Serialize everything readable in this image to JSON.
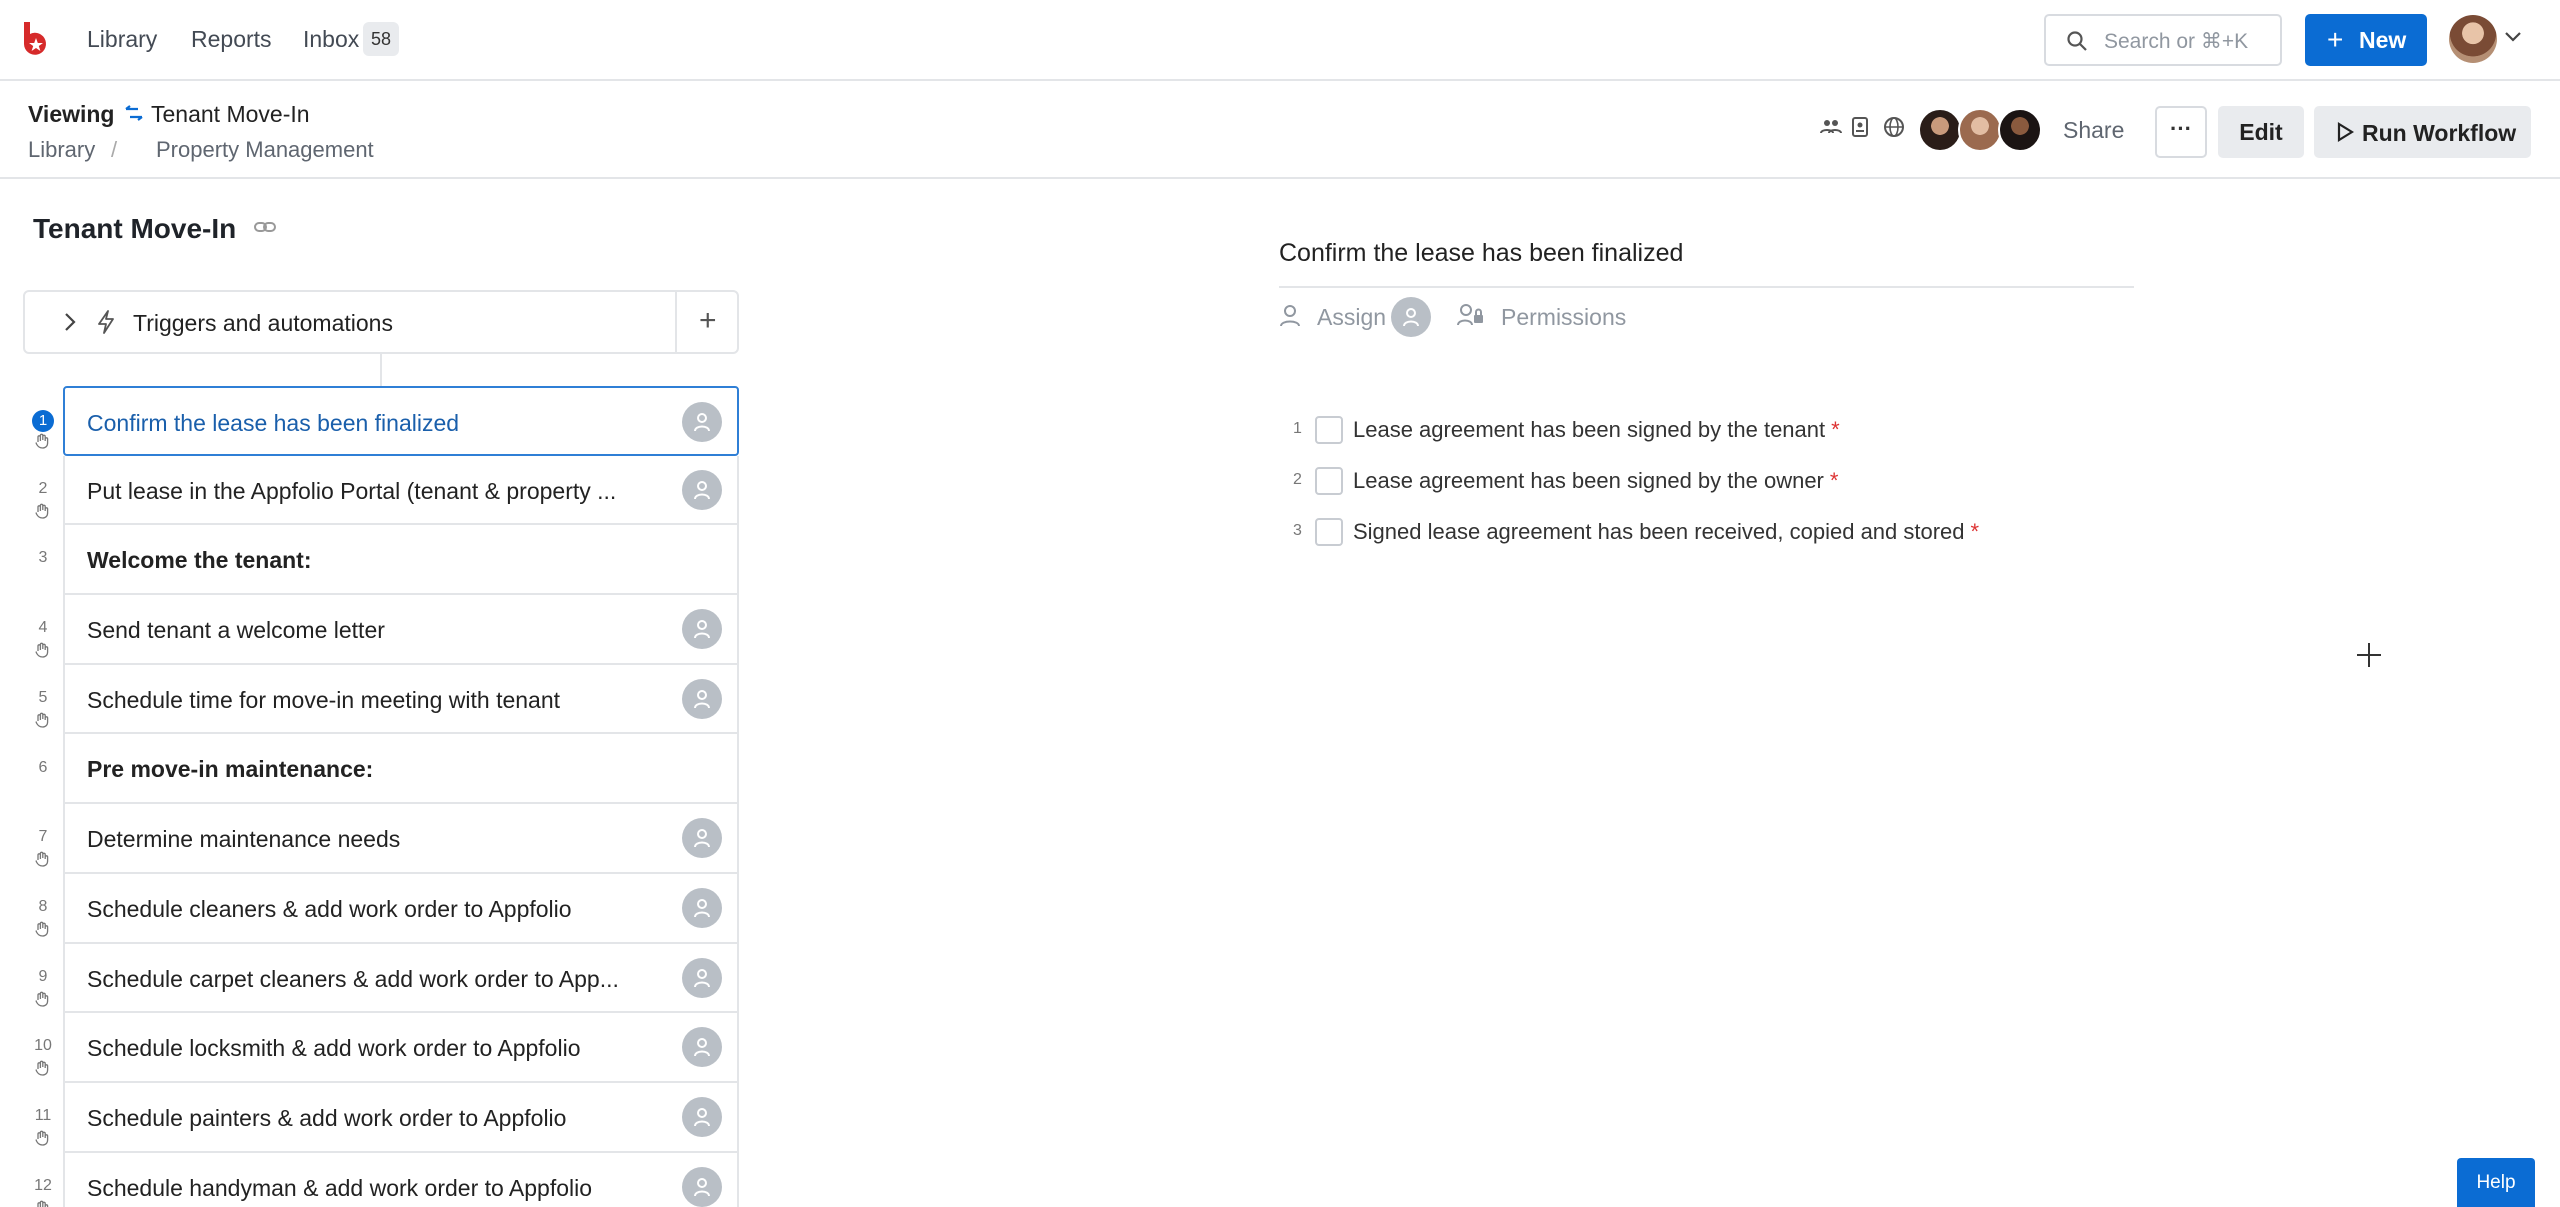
{
  "nav": {
    "library": "Library",
    "reports": "Reports",
    "inbox": "Inbox",
    "inbox_count": "58",
    "search_placeholder": "Search or ⌘+K",
    "new_label": "New"
  },
  "header": {
    "viewing": "Viewing",
    "workflow_title": "Tenant Move-In",
    "breadcrumb": [
      "Library",
      "Property Management"
    ],
    "share": "Share",
    "more": "···",
    "edit": "Edit",
    "run": "Run Workflow"
  },
  "workflow": {
    "title": "Tenant Move-In",
    "triggers_label": "Triggers and automations",
    "add_label": "+",
    "tasks": [
      {
        "num": "1",
        "text": "Confirm the lease has been finalized",
        "type": "task",
        "active": true
      },
      {
        "num": "2",
        "text": "Put lease in the Appfolio Portal (tenant & property ...",
        "type": "task"
      },
      {
        "num": "3",
        "text": "Welcome the tenant:",
        "type": "heading"
      },
      {
        "num": "4",
        "text": "Send tenant a welcome letter",
        "type": "task"
      },
      {
        "num": "5",
        "text": "Schedule time for move-in meeting with tenant",
        "type": "task"
      },
      {
        "num": "6",
        "text": "Pre move-in maintenance:",
        "type": "heading"
      },
      {
        "num": "7",
        "text": "Determine maintenance needs",
        "type": "task"
      },
      {
        "num": "8",
        "text": "Schedule cleaners & add work order to Appfolio",
        "type": "task"
      },
      {
        "num": "9",
        "text": "Schedule carpet cleaners & add work order to App...",
        "type": "task"
      },
      {
        "num": "10",
        "text": "Schedule locksmith & add work order to Appfolio",
        "type": "task"
      },
      {
        "num": "11",
        "text": "Schedule painters & add work order to Appfolio",
        "type": "task"
      },
      {
        "num": "12",
        "text": "Schedule handyman & add work order to Appfolio",
        "type": "task"
      }
    ]
  },
  "detail": {
    "title": "Confirm the lease has been finalized",
    "assign": "Assign",
    "permissions": "Permissions",
    "checklist": [
      {
        "num": "1",
        "text": "Lease agreement has been signed by the tenant",
        "required": "*"
      },
      {
        "num": "2",
        "text": "Lease agreement has been signed by the owner",
        "required": "*"
      },
      {
        "num": "3",
        "text": "Signed lease agreement has been received, copied and stored",
        "required": "*"
      }
    ]
  },
  "help": "Help",
  "colors": {
    "accent": "#0b6cd3",
    "active_text": "#1a5fab",
    "required": "#dd3333"
  }
}
